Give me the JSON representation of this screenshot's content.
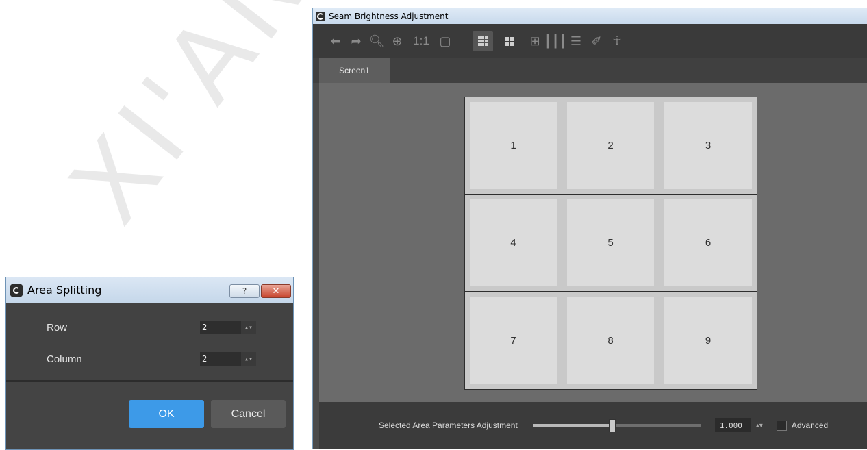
{
  "watermark": "XI'AN N",
  "main_window": {
    "title": "Seam Brightness Adjustment",
    "toolbar": {
      "undo_icon": "undo-arrow",
      "redo_icon": "redo-arrow",
      "zoom_out_icon": "zoom-out",
      "zoom_in_icon": "zoom-in",
      "actual_size_label": "1:1",
      "fit_icon": "fit-to-window",
      "eraser_icon": "eraser",
      "brush_icon": "broom"
    },
    "tabs": [
      {
        "label": "Screen1",
        "selected": true
      }
    ],
    "tiles": [
      "1",
      "2",
      "3",
      "4",
      "5",
      "6",
      "7",
      "8",
      "9"
    ],
    "bottom": {
      "param_label": "Selected Area Parameters Adjustment",
      "slider_value": 0.47,
      "value": "1.000",
      "advanced_label": "Advanced",
      "advanced_checked": false
    }
  },
  "dialog": {
    "title": "Area Splitting",
    "help_label": "?",
    "close_label": "✕",
    "row_label": "Row",
    "row_value": "2",
    "column_label": "Column",
    "column_value": "2",
    "ok_label": "OK",
    "cancel_label": "Cancel"
  }
}
